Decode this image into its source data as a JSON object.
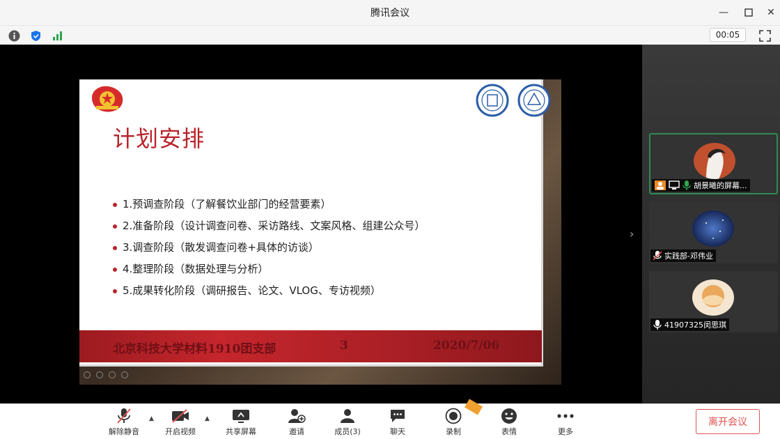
{
  "window": {
    "title": "腾讯会议"
  },
  "status": {
    "timer": "00:05"
  },
  "slide": {
    "title": "计划安排",
    "bullets": [
      "1.预调查阶段（了解餐饮业部门的经营要素）",
      "2.准备阶段（设计调查问卷、采访路线、文案风格、组建公众号）",
      "3.调查阶段（散发调查问卷+具体的访谈）",
      "4.整理阶段（数据处理与分析）",
      "5.成果转化阶段（调研报告、论文、VLOG、专访视频）"
    ],
    "footer": {
      "org": "北京科技大学材料1910团支部",
      "page": "3",
      "date": "2020/7/06"
    }
  },
  "participants": [
    {
      "name": "胡景曦的屏幕...",
      "active": true
    },
    {
      "name": "实践部-邓伟业",
      "active": false
    },
    {
      "name": "41907325闵思琪",
      "active": false
    }
  ],
  "toolbar": {
    "mute": "解除静音",
    "video": "开启视频",
    "share": "共享屏幕",
    "invite": "邀请",
    "members": "成员(3)",
    "chat": "聊天",
    "record": "录制",
    "reactions": "表情",
    "more": "更多",
    "leave": "离开会议"
  },
  "colors": {
    "accent_red": "#b8242a",
    "leave_red": "#e0534f",
    "active_border": "#2e8b57"
  }
}
